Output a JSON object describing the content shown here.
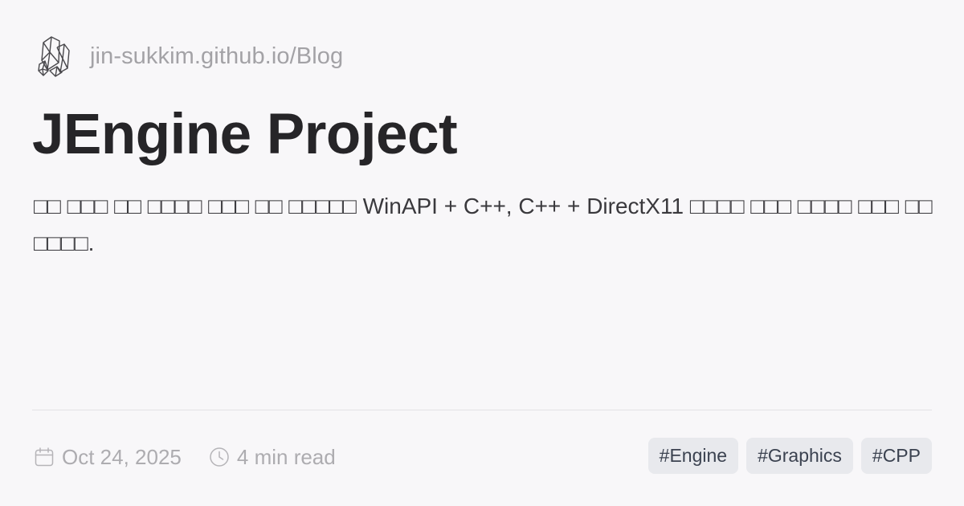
{
  "site": {
    "logo_icon": "crystal-logo-icon",
    "url": "jin-sukkim.github.io/Blog"
  },
  "post": {
    "title": "JEngine Project",
    "description": "□□ □□□ □□ □□□□ □□□ □□ □□□□□ WinAPI + C++, C++ + DirectX11 □□□□ □□□ □□□□ □□□ □□□□□□."
  },
  "meta": {
    "date_icon": "calendar-icon",
    "date": "Oct 24, 2025",
    "read_icon": "clock-icon",
    "read_time": "4 min read"
  },
  "tags": [
    {
      "label": "#Engine"
    },
    {
      "label": "#Graphics"
    },
    {
      "label": "#CPP"
    }
  ],
  "colors": {
    "background": "#f8f7f9",
    "title": "#262528",
    "muted": "#a3a2a6",
    "tag_background": "#e8e9ed",
    "tag_text": "#3b4250"
  }
}
